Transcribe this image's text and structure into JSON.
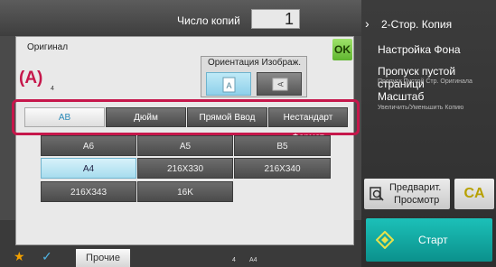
{
  "header": {
    "copies_label": "Число копий",
    "copies_value": "1"
  },
  "right_panel": {
    "duplex": "2-Стор. Копия",
    "background": "Настройка Фона",
    "blank_skip": "Пропуск пустой страници",
    "blank_skip_sub": "Пропуск Пустой Стр. Оригинала",
    "scale": "Масштаб",
    "scale_sub": "Увеличить/Уменьшить Копию",
    "preview_line1": "Предварит.",
    "preview_line2": "Просмотр",
    "ca": "CA",
    "start": "Старт"
  },
  "bottom": {
    "other": "Прочие",
    "page_a": "4",
    "page_b": "A4"
  },
  "dialog": {
    "title": "Оригинал",
    "ok": "OK",
    "orientation_title": "Ориентация Изображ.",
    "callout": "(A)",
    "callout_sub": "4"
  },
  "tabs": [
    {
      "label": "AB",
      "selected": true
    },
    {
      "label": "Дюйм",
      "selected": false
    },
    {
      "label": "Прямой Ввод",
      "selected": false
    },
    {
      "label": "Нестандарт Формат",
      "selected": false
    }
  ],
  "paper_sizes": [
    {
      "label": "A6",
      "selected": false
    },
    {
      "label": "A5",
      "selected": false
    },
    {
      "label": "B5",
      "selected": false
    },
    {
      "label": "A4",
      "selected": true
    },
    {
      "label": "216X330",
      "selected": false
    },
    {
      "label": "216X340",
      "selected": false
    },
    {
      "label": "216X343",
      "selected": false
    },
    {
      "label": "16K",
      "selected": false
    }
  ],
  "colors": {
    "highlight": "#c6174b",
    "selected": "#a7dcee",
    "start": "#12a9a2",
    "ok": "#74c63f"
  }
}
